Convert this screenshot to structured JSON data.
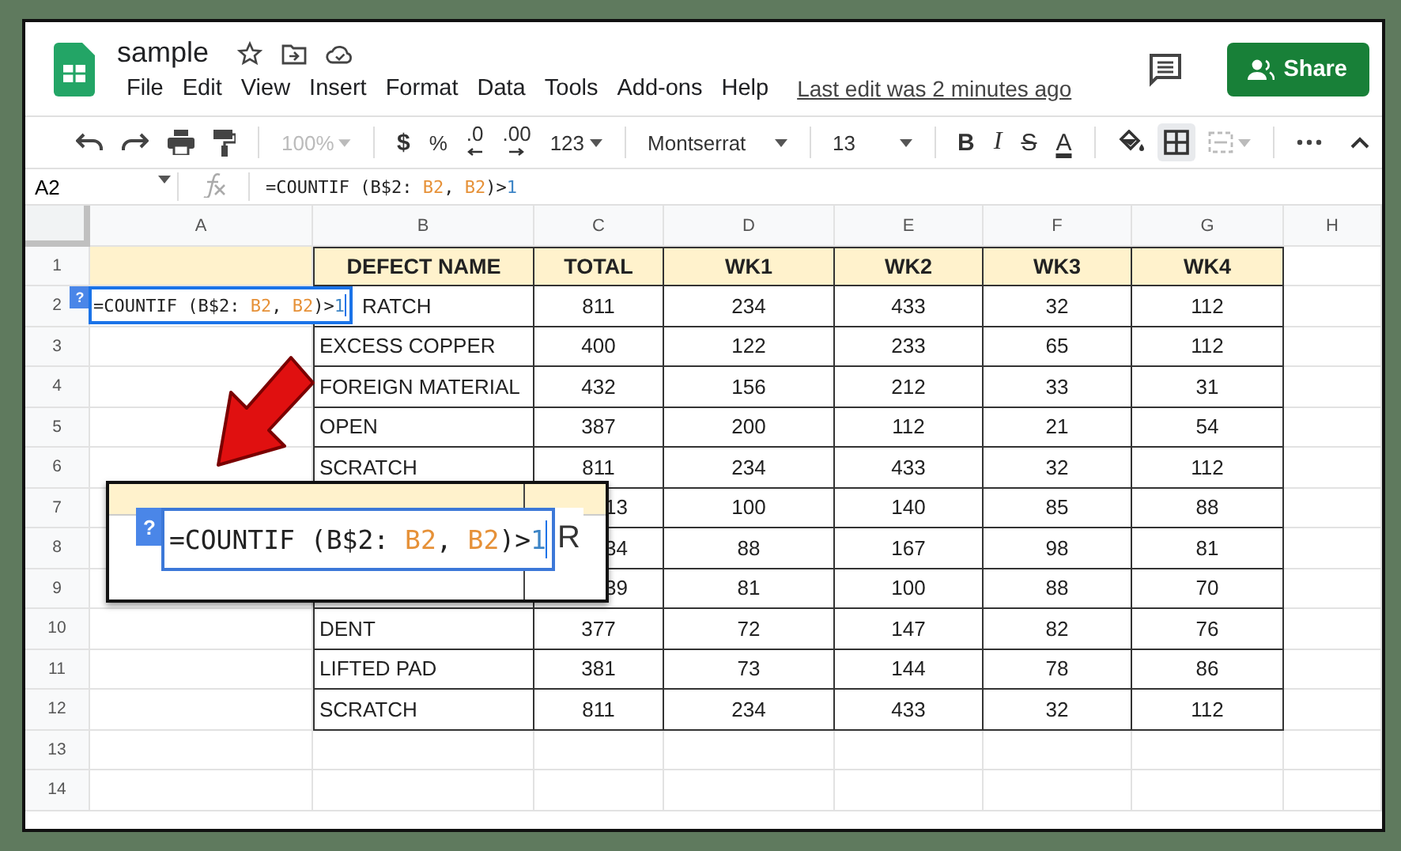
{
  "document": {
    "title": "sample",
    "menu": [
      "File",
      "Edit",
      "View",
      "Insert",
      "Format",
      "Data",
      "Tools",
      "Add-ons",
      "Help"
    ],
    "last_edit": "Last edit was 2 minutes ago",
    "share": "Share"
  },
  "toolbar": {
    "zoom": {
      "value": "100%",
      "disabled": true
    },
    "currency": "$",
    "percent": "%",
    "decrease_decimals": ".0",
    "increase_decimals": ".00",
    "number_format": "123",
    "font": "Montserrat",
    "font_size": "13",
    "bold": "B",
    "italic": "I",
    "strikethrough": "S",
    "text_color": "A",
    "borders_selected": true,
    "merge_disabled": true
  },
  "formula_bar": {
    "cell": "A2",
    "formula": [
      {
        "text": "=COUNTIF (B$2: ",
        "kind": "plain"
      },
      {
        "text": "B2",
        "kind": "ref"
      },
      {
        "text": ", ",
        "kind": "plain"
      },
      {
        "text": "B2",
        "kind": "ref"
      },
      {
        "text": ")>",
        "kind": "plain"
      },
      {
        "text": "1",
        "kind": "number"
      }
    ]
  },
  "sheet": {
    "columns": [
      "A",
      "B",
      "C",
      "D",
      "E",
      "F",
      "G",
      "H"
    ],
    "rows": [
      {
        "number": "1",
        "header": true,
        "defect": "DEFECT NAME",
        "total": "TOTAL",
        "weeks": [
          "WK1",
          "WK2",
          "WK3",
          "WK4"
        ]
      },
      {
        "number": "2",
        "header": false,
        "editor_over": true,
        "defect": "RATCH",
        "total": "811",
        "weeks": [
          "234",
          "433",
          "32",
          "112"
        ]
      },
      {
        "number": "3",
        "header": false,
        "defect": "EXCESS COPPER",
        "total": "400",
        "weeks": [
          "122",
          "233",
          "65",
          "112"
        ]
      },
      {
        "number": "4",
        "header": false,
        "defect": "FOREIGN MATERIAL",
        "total": "432",
        "weeks": [
          "156",
          "212",
          "33",
          "31"
        ]
      },
      {
        "number": "5",
        "header": false,
        "defect": "OPEN",
        "total": "387",
        "weeks": [
          "200",
          "112",
          "21",
          "54"
        ]
      },
      {
        "number": "6",
        "header": false,
        "defect": "SCRATCH",
        "total": "811",
        "weeks": [
          "234",
          "433",
          "32",
          "112"
        ]
      },
      {
        "number": "7",
        "header": false,
        "under_callout": true,
        "total": "13",
        "weeks": [
          "100",
          "140",
          "85",
          "88"
        ]
      },
      {
        "number": "8",
        "header": false,
        "under_callout": true,
        "total": "34",
        "weeks": [
          "88",
          "167",
          "98",
          "81"
        ]
      },
      {
        "number": "9",
        "header": false,
        "under_callout": true,
        "total": "39",
        "weeks": [
          "81",
          "100",
          "88",
          "70"
        ]
      },
      {
        "number": "10",
        "header": false,
        "defect": "DENT",
        "total": "377",
        "weeks": [
          "72",
          "147",
          "82",
          "76"
        ]
      },
      {
        "number": "11",
        "header": false,
        "defect": "LIFTED PAD",
        "total": "381",
        "weeks": [
          "73",
          "144",
          "78",
          "86"
        ]
      },
      {
        "number": "12",
        "header": false,
        "defect": "SCRATCH",
        "total": "811",
        "weeks": [
          "234",
          "433",
          "32",
          "112"
        ]
      },
      {
        "number": "13"
      },
      {
        "number": "14"
      }
    ],
    "cell_editor": {
      "help": "?",
      "formula": [
        {
          "text": "=COUNTIF (B$2: ",
          "kind": "plain"
        },
        {
          "text": "B2",
          "kind": "ref"
        },
        {
          "text": ", ",
          "kind": "plain"
        },
        {
          "text": "B2",
          "kind": "ref"
        },
        {
          "text": ")>",
          "kind": "plain"
        },
        {
          "text": "1",
          "kind": "number"
        }
      ]
    }
  },
  "callout": {
    "help": "?",
    "formula": [
      {
        "text": "=COUNTIF (B$2: ",
        "kind": "plain"
      },
      {
        "text": "B2",
        "kind": "ref"
      },
      {
        "text": ", ",
        "kind": "plain"
      },
      {
        "text": "B2",
        "kind": "ref"
      },
      {
        "text": ")>",
        "kind": "plain"
      },
      {
        "text": "1",
        "kind": "number"
      }
    ],
    "trailing_text": "R"
  }
}
